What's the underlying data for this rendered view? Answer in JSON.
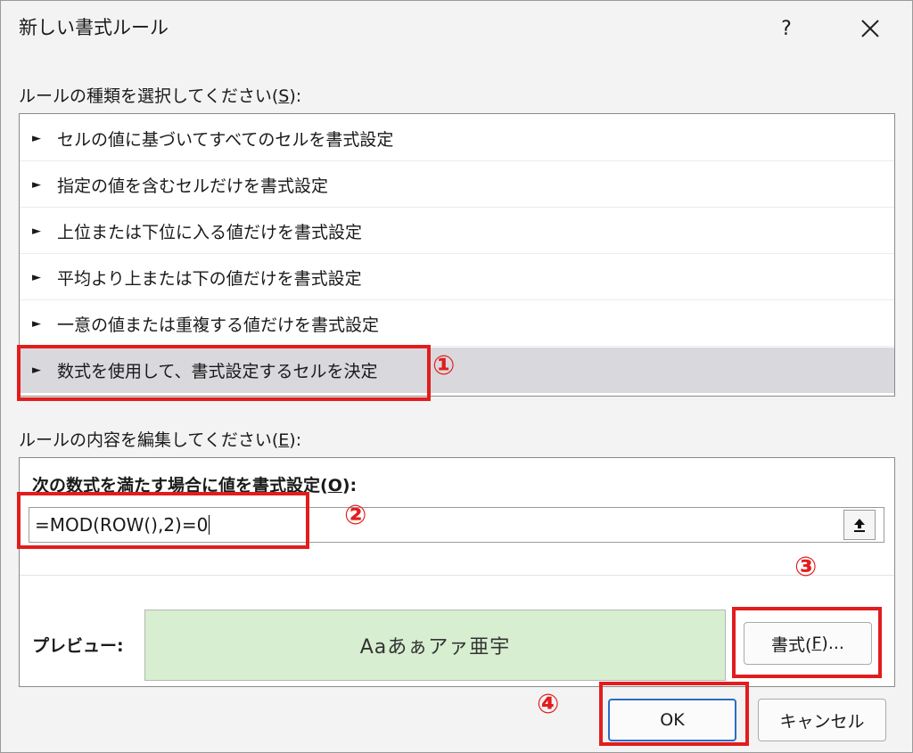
{
  "dialog": {
    "title": "新しい書式ルール",
    "help": "?",
    "close_icon": "close-icon"
  },
  "rule_type": {
    "label_pre": "ルールの種類を選択してください(",
    "label_key": "S",
    "label_post": "):",
    "items": [
      {
        "label": "セルの値に基づいてすべてのセルを書式設定",
        "selected": false
      },
      {
        "label": "指定の値を含むセルだけを書式設定",
        "selected": false
      },
      {
        "label": "上位または下位に入る値だけを書式設定",
        "selected": false
      },
      {
        "label": "平均より上または下の値だけを書式設定",
        "selected": false
      },
      {
        "label": "一意の値または重複する値だけを書式設定",
        "selected": false
      },
      {
        "label": "数式を使用して、書式設定するセルを決定",
        "selected": true
      }
    ],
    "bullet": "►"
  },
  "rule_desc": {
    "label_pre": "ルールの内容を編集してください(",
    "label_key": "E",
    "label_post": "):",
    "formula_label_pre": "次の数式を満たす場合に値を書式設定(",
    "formula_label_key": "O",
    "formula_label_post": "):",
    "formula_value": "=MOD(ROW(),2)=0",
    "collapse_icon": "collapse-dialog-icon",
    "preview_label": "プレビュー:",
    "preview_text": "Aaあぁアァ亜宇",
    "preview_fill": "#d7eed0",
    "format_pre": "書式(",
    "format_key": "F",
    "format_post": ")..."
  },
  "buttons": {
    "ok": "OK",
    "cancel": "キャンセル"
  },
  "annotations": {
    "color": "#e21d1d",
    "markers": [
      "①",
      "②",
      "③",
      "④"
    ]
  }
}
